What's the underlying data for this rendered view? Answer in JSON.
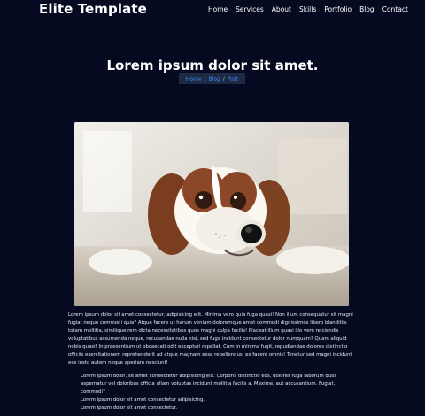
{
  "header": {
    "brand": "Elite Template",
    "nav": [
      "Home",
      "Services",
      "About",
      "Skills",
      "Portfolio",
      "Blog",
      "Contact"
    ]
  },
  "hero": {
    "title": "Lorem ipsum dolor sit amet.",
    "breadcrumb": [
      "Home",
      "Blog",
      "Post"
    ],
    "separator": "/"
  },
  "colors": {
    "background": "#060a20",
    "text": "#e7eaf3",
    "accent": "#3b82f6",
    "breadcrumb_bg": "#1d2a44"
  },
  "image": {
    "subject": "dog-photo"
  },
  "article": {
    "paragraph": "Lorem ipsum dolor sit amet consectetur, adipisicing elit. Minima vero quia fuga quasi! Non illum consequatur sit magni fugiat neque commodi quia? Atque facere ut harum veniam doloremque amet commodi dignissimos libero blanditiis totam mollitia, similique rem dicta necessitatibus quos magni culpa facilis! Placeat illum quasi illo vero reiciendis voluptatibus assumenda neque, recusandae nulla nisi, sed fuga incidunt consectetur dolor numquam? Quam aliquid nobis quasi! In praesentium ut obcaecati odit excepturi repellat. Cum in minima fugit, repudiandae dolores distinctio officiis exercitationem reprehenderit ad atque magnam esse repellendus, ex facere omnis! Tenetur sed magni incidunt eos iusto autem neque aperiam nesciunt!",
    "bullets": [
      "Lorem ipsum dolor, sit amet consectetur adipisicing elit. Corporis distinctio eos, dolores fuga laborum quos aspernatur vel doloribus officia ullam voluptas incidunt mollitia facilis a. Maxime, aut accusantium. Fugiat, commodi?",
      "Lorem ipsum dolor sit amet consectetur adipisicing.",
      "Lorem ipsum dolor sit amet consectetur."
    ]
  }
}
